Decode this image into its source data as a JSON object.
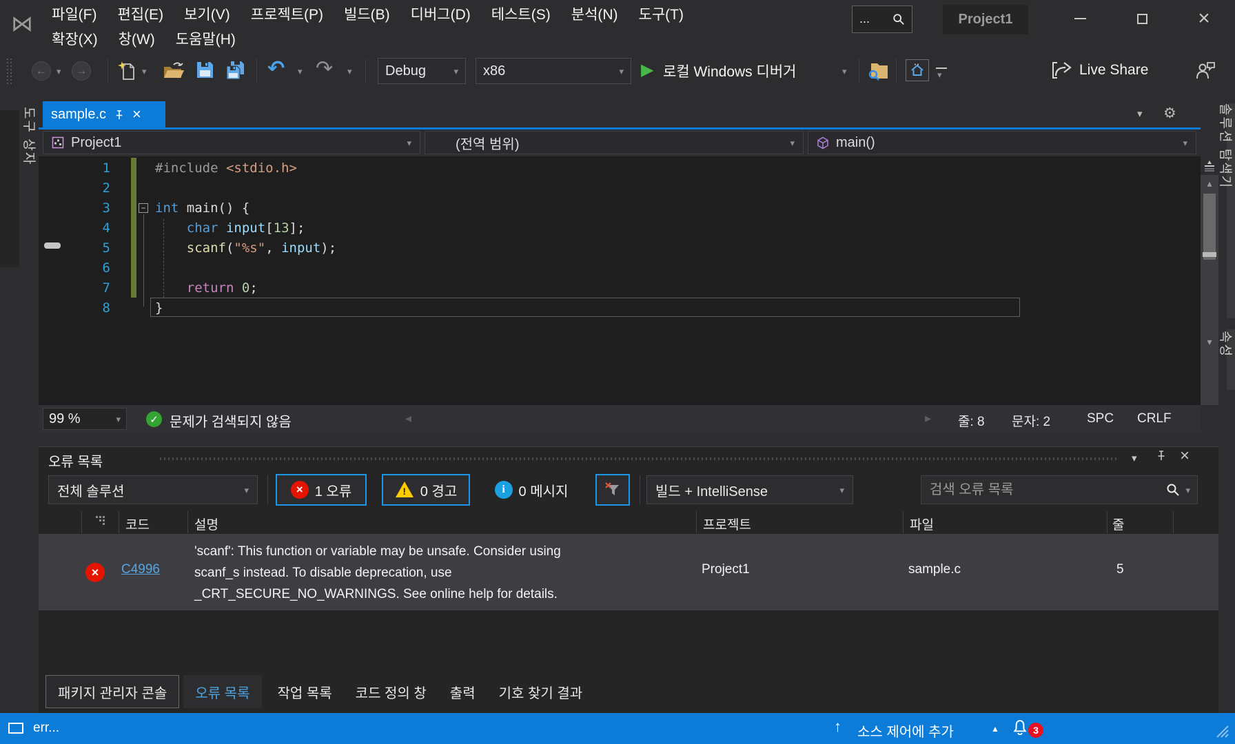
{
  "window": {
    "title": "Project1",
    "search_text": "..."
  },
  "menu": {
    "row1": [
      "파일(F)",
      "편집(E)",
      "보기(V)",
      "프로젝트(P)",
      "빌드(B)",
      "디버그(D)",
      "테스트(S)",
      "분석(N)",
      "도구(T)"
    ],
    "row2": [
      "확장(X)",
      "창(W)",
      "도움말(H)"
    ]
  },
  "toolbar": {
    "config": "Debug",
    "platform": "x86",
    "run_label": "로컬 Windows 디버거",
    "live_share_label": "Live Share"
  },
  "rails": {
    "left_tab": "도구 상자",
    "right_tabs": [
      "솔루션 탐색기",
      "속성"
    ]
  },
  "editor": {
    "tab_title": "sample.c",
    "navbar": {
      "project": "Project1",
      "scope": "(전역 범위)",
      "member": "main()"
    },
    "code": {
      "lines": [
        {
          "num": "1",
          "tokens": [
            [
              "pp",
              "#include "
            ],
            [
              "str",
              "<stdio.h>"
            ]
          ]
        },
        {
          "num": "2",
          "tokens": []
        },
        {
          "num": "3",
          "tokens": [
            [
              "kw",
              "int"
            ],
            [
              "pl",
              " main() {"
            ]
          ]
        },
        {
          "num": "4",
          "tokens": [
            [
              "pl",
              "    "
            ],
            [
              "kw",
              "char"
            ],
            [
              "pl",
              " "
            ],
            [
              "var",
              "input"
            ],
            [
              "pl",
              "["
            ],
            [
              "num",
              "13"
            ],
            [
              "pl",
              "];"
            ]
          ]
        },
        {
          "num": "5",
          "tokens": [
            [
              "pl",
              "    "
            ],
            [
              "fn",
              "scanf"
            ],
            [
              "pl",
              "("
            ],
            [
              "str",
              "\"%s\""
            ],
            [
              "pl",
              ", "
            ],
            [
              "var",
              "input"
            ],
            [
              "pl",
              ");"
            ]
          ]
        },
        {
          "num": "6",
          "tokens": []
        },
        {
          "num": "7",
          "tokens": [
            [
              "pl",
              "    "
            ],
            [
              "ctl",
              "return"
            ],
            [
              "pl",
              " "
            ],
            [
              "num",
              "0"
            ],
            [
              "pl",
              ";"
            ]
          ]
        },
        {
          "num": "8",
          "tokens": [
            [
              "pl",
              "}"
            ]
          ]
        }
      ]
    },
    "statusbar": {
      "zoom": "99 %",
      "health": "문제가 검색되지 않음",
      "line": "줄: 8",
      "column": "문자: 2",
      "spaces": "SPC",
      "line_ending": "CRLF"
    }
  },
  "error_list": {
    "title": "오류 목록",
    "scope_filter": "전체 솔루션",
    "error_toggle": "1 오류",
    "warning_toggle": "0 경고",
    "message_toggle": "0 메시지",
    "source_filter": "빌드 + IntelliSense",
    "search_placeholder": "검색 오류 목록",
    "columns": [
      "코드",
      "설명",
      "프로젝트",
      "파일",
      "줄"
    ],
    "rows": [
      {
        "code": "C4996",
        "description": "'scanf': This function or variable may be unsafe. Consider using scanf_s instead. To disable deprecation, use _CRT_SECURE_NO_WARNINGS. See online help for details.",
        "project": "Project1",
        "file": "sample.c",
        "line": "5"
      }
    ]
  },
  "panel_tabs": [
    "패키지 관리자 콘솔",
    "오류 목록",
    "작업 목록",
    "코드 정의 창",
    "출력",
    "기호 찾기 결과"
  ],
  "status_bar": {
    "left_text": "err...",
    "source_control_label": "소스 제어에 추가",
    "notification_count": "3"
  },
  "icons": {
    "logo": "⋈",
    "caret": "▾",
    "gear": "⚙",
    "close": "×",
    "play": "▶",
    "check": "✓",
    "undo": "↶",
    "redo": "↷",
    "back": "←",
    "forward": "→",
    "minus": "−",
    "up_small": "▴",
    "down_small": "▾",
    "left_small": "◂",
    "right_small": "▸",
    "up_arrow": "↑",
    "tri_up": "▲",
    "bang": "!",
    "info_i": "i",
    "x_mark": "×"
  },
  "colors": {
    "accent": "#0C7CD8",
    "toggle_border": "#1C97EA",
    "error_red": "#E51400",
    "warning_yellow": "#FFCC00",
    "info_blue": "#1BA1E2",
    "editor_bg": "#1E1E1E",
    "panel_bg": "#252526",
    "chrome_bg": "#2D2D30",
    "change_bar_green": "#667B34"
  }
}
